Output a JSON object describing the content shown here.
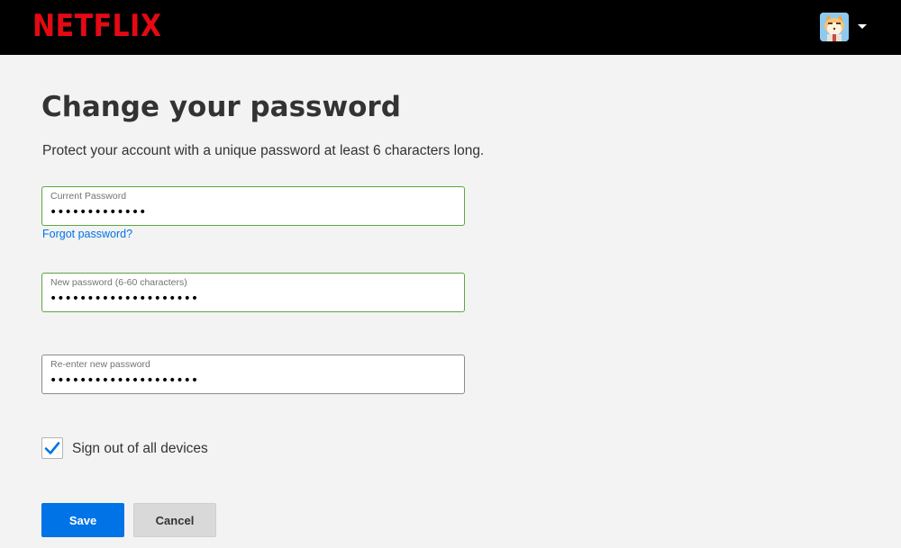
{
  "header": {
    "logo_text": "NETFLIX",
    "brand_color": "#e50914",
    "profile": {
      "avatar_icon": "aggretsuko-avatar",
      "menu_icon": "caret-down-icon"
    }
  },
  "page": {
    "title": "Change your password",
    "subtitle": "Protect your account with a unique password at least 6 characters long."
  },
  "fields": {
    "current": {
      "label": "Current Password",
      "value": "•••••••••••••"
    },
    "forgot_link": "Forgot password?",
    "new": {
      "label": "New password (6-60 characters)",
      "value": "••••••••••••••••••••"
    },
    "confirm": {
      "label": "Re-enter new password",
      "value": "••••••••••••••••••••"
    }
  },
  "sign_out_all": {
    "label": "Sign out of all devices",
    "checked": true
  },
  "buttons": {
    "save": "Save",
    "cancel": "Cancel"
  },
  "colors": {
    "accent_blue": "#0073e6",
    "valid_border": "#5fa53f",
    "background": "#f3f3f3"
  }
}
